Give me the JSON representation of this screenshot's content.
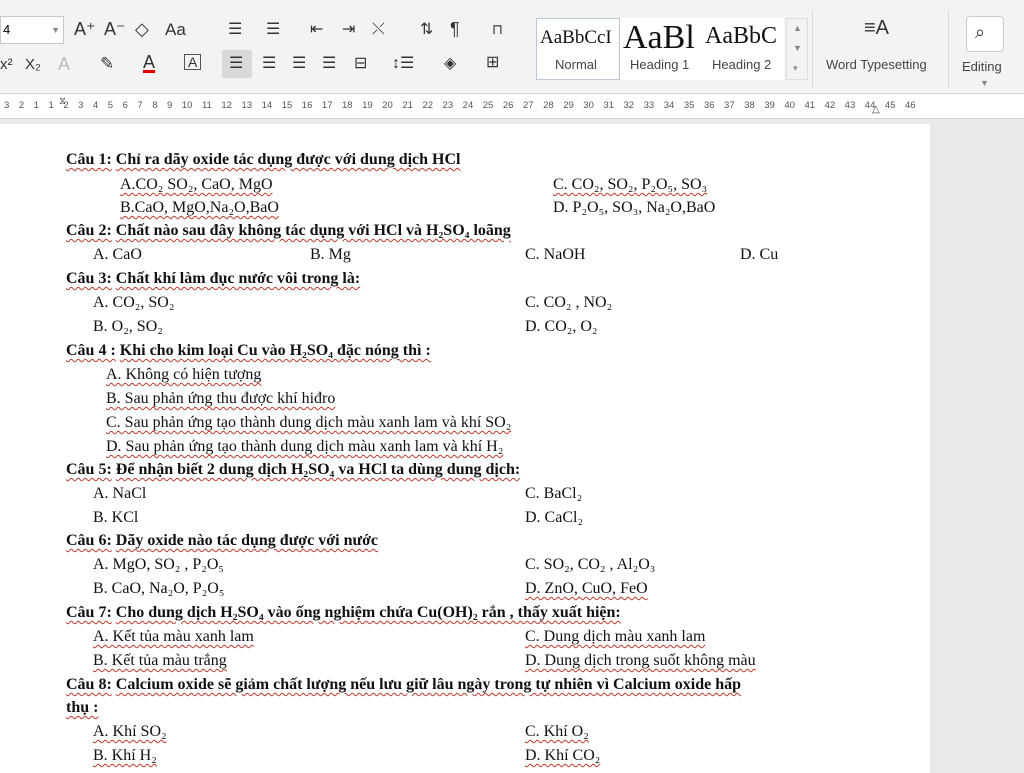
{
  "ribbon": {
    "font_size": "4",
    "grow_font": "A⁺",
    "shrink_font": "A⁻",
    "change_case": "Aa",
    "superscript": "x²",
    "subscript": "X₂",
    "styles": [
      {
        "sample": "AaBbCcI",
        "name": "Normal"
      },
      {
        "sample": "AaBl",
        "name": "Heading 1"
      },
      {
        "sample": "AaBbC",
        "name": "Heading 2"
      }
    ],
    "word_typesetting": "Word Typesetting",
    "editing": "Editing"
  },
  "ruler": {
    "numbers": "3 2 1 1 2 3 4 5 6 7 8 9 10 11 12 13 14 15 16 17 18 19 20 21 22 23 24 25 26 27 28 29 30 31 32 33 34 35 36 37 38 39 40 41 42 43 44 45 46"
  },
  "document": {
    "q1": {
      "label": "Câu 1:",
      "text": "Chỉ ra dãy oxide tác dụng được với dung dịch HCl",
      "a": "A.CO₂ SO₂, CaO, MgO",
      "b": "B.CaO, MgO,Na₂O,BaO",
      "c": "C. CO₂, SO₂, P₂O₅, SO₃",
      "d": "D. P₂O₅, SO₃, Na₂O,BaO"
    },
    "q2": {
      "label": "Câu 2:",
      "text": "Chất nào sau đây không tác dụng với HCl và H₂SO₄ loãng",
      "a": "A. CaO",
      "b": "B. Mg",
      "c": "C. NaOH",
      "d": "D. Cu"
    },
    "q3": {
      "label": "Câu 3:",
      "text": "Chất khí làm đục nước vôi trong là:",
      "a": "A. CO₂, SO₂",
      "b": "B. O₂, SO₂",
      "c": "C. CO₂ , NO₂",
      "d": "D. CO₂, O₂"
    },
    "q4": {
      "label": "Câu 4 :",
      "text": "Khi cho kim loại Cu vào H₂SO₄ đặc nóng thì :",
      "a": "A. Không có hiện tượng",
      "b": "B. Sau phản ứng thu được khí hiđro",
      "c": "C. Sau phản ứng tạo thành dung dịch màu xanh lam và khí SO₂",
      "d": "D. Sau phản ứng tạo thành dung dịch màu xanh lam và khí H₂"
    },
    "q5": {
      "label": "Câu 5:",
      "text": "Để nhận biết 2 dung dịch H₂SO₄ va HCl ta dùng dung dịch:",
      "a": "A. NaCl",
      "b": "B. KCl",
      "c": "C. BaCl₂",
      "d": "D. CaCl₂"
    },
    "q6": {
      "label": "Câu 6:",
      "text": "Dãy oxide nào tác dụng được với nước",
      "a": "A. MgO, SO₂ , P₂O₅",
      "b": "B. CaO, Na₂O, P₂O₅",
      "c": "C. SO₂, CO₂ , Al₂O₃",
      "d": "D. ZnO, CuO, FeO"
    },
    "q7": {
      "label": "Câu 7:",
      "text": "Cho dung dịch H₂SO₄ vào ống nghiệm chứa Cu(OH)₂ rắn , thấy xuất hiện:",
      "a": "A. Kết tủa màu xanh lam",
      "b": "B. Kết tủa màu trắng",
      "c": "C. Dung dịch màu xanh lam",
      "d": "D. Dung dịch trong suốt không màu"
    },
    "q8": {
      "label": "Câu 8:",
      "text": "Calcium oxide sẽ giảm chất lượng nếu lưu giữ lâu ngày trong tự nhiên vì Calcium oxide hấp",
      "text2": "thụ :",
      "a": "A. Khí SO₂",
      "b": "B. Khí H₂",
      "c": "C. Khí O₂",
      "d": "D. Khí CO₂"
    }
  }
}
